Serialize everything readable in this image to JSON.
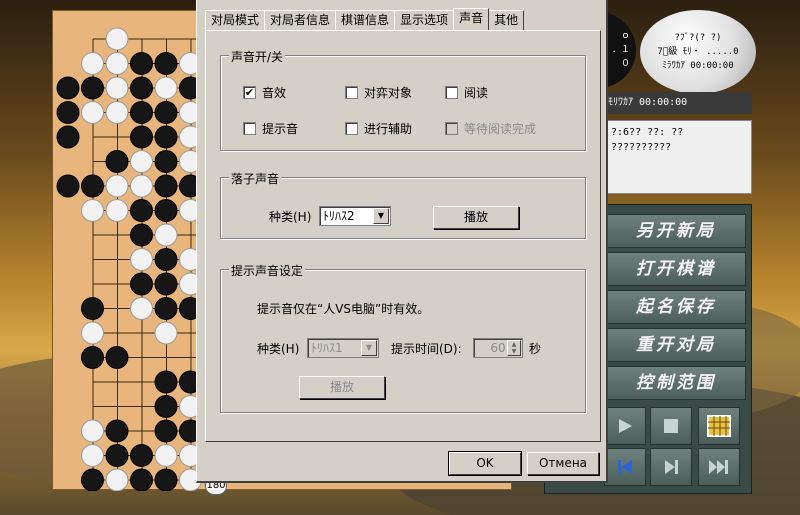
{
  "dialog": {
    "tabs": [
      "对局模式",
      "对局者信息",
      "棋谱信息",
      "显示选项",
      "声音",
      "其他"
    ],
    "active_tab": 4,
    "sound_toggle": {
      "title": "声音开/关",
      "sound_effects": {
        "label": "音效",
        "checked": true
      },
      "abandon_target": {
        "label": "对弈对象",
        "checked": false
      },
      "read_aloud": {
        "label": "阅读",
        "checked": false
      },
      "hint_sound": {
        "label": "提示音",
        "checked": false
      },
      "progress_assist": {
        "label": "进行辅助",
        "checked": false
      },
      "wait_read_done": {
        "label": "等待阅读完成",
        "checked": false,
        "disabled": true
      }
    },
    "stone_sound": {
      "title": "落子声音",
      "type_label": "种类(H)",
      "type_value": "ﾄﾘﾊｽ2",
      "play_label": "播放"
    },
    "hint_sound_settings": {
      "title": "提示声音设定",
      "note": "提示音仅在“人VS电脑”时有效。",
      "type_label": "种类(H)",
      "type_value": "ﾄﾘﾊｽ1",
      "time_label": "提示时间(D):",
      "time_value": "60",
      "unit": "秒",
      "play_label": "播放"
    },
    "ok_label": "OK",
    "cancel_label": "Отмена"
  },
  "board": {
    "move_number": "180"
  },
  "side": {
    "black_clock_lines": [
      "ｏ",
      "．１",
      "０"
    ],
    "white_clock_lines": [
      "?ﾌﾞ?(? ?)",
      "7ﾞ級 ﾓﾘ・ .....0",
      "ﾐﾗﾜｶｱ 00:00:00"
    ],
    "timer_text": "ﾓﾘﾜｶｱ     00:00:00",
    "info_lines": [
      "?:6??    ??: ??",
      "  ??????????"
    ],
    "menu": [
      "另开新局",
      "打开棋谱",
      "起名保存",
      "重开对局",
      "控制范围"
    ]
  },
  "icons": [
    "play-icon",
    "stop-icon",
    "grid-icon",
    "first-icon",
    "next-icon",
    "last-icon"
  ],
  "colors": {
    "dialog_bg": "#d4d0c8",
    "menu_btn": "#5d706b",
    "board": "#e8b57c"
  }
}
